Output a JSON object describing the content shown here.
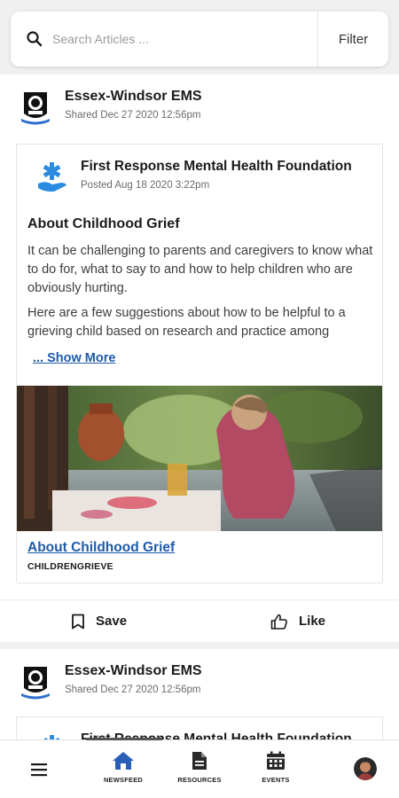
{
  "search": {
    "placeholder": "Search Articles ...",
    "value": "",
    "filter_label": "Filter"
  },
  "posts": [
    {
      "org_name": "Essex-Windsor EMS",
      "shared_date": "Shared Dec 27 2020 12:56pm",
      "source_name": "First Response Mental Health Foundation",
      "posted_date": "Posted Aug 18 2020 3:22pm",
      "article_title": "About Childhood Grief",
      "paragraphs": [
        "It can be challenging to parents and caregivers to know what to do for, what to say to and how to help children who are obviously hurting.",
        "Here are a few suggestions about how to be helpful to a grieving child based on research and practice among"
      ],
      "show_more": "... Show More",
      "link_title": "About Childhood Grief",
      "link_source": "CHILDRENGRIEVE",
      "save_label": "Save",
      "like_label": "Like"
    },
    {
      "org_name": "Essex-Windsor EMS",
      "shared_date": "Shared Dec 27 2020 12:56pm",
      "source_name": "First Response Mental Health Foundation"
    }
  ],
  "nav": {
    "newsfeed": "NEWSFEED",
    "resources": "RESOURCES",
    "events": "EVENTS"
  },
  "colors": {
    "accent": "#1e5aa8",
    "background": "#f0f0f0"
  }
}
